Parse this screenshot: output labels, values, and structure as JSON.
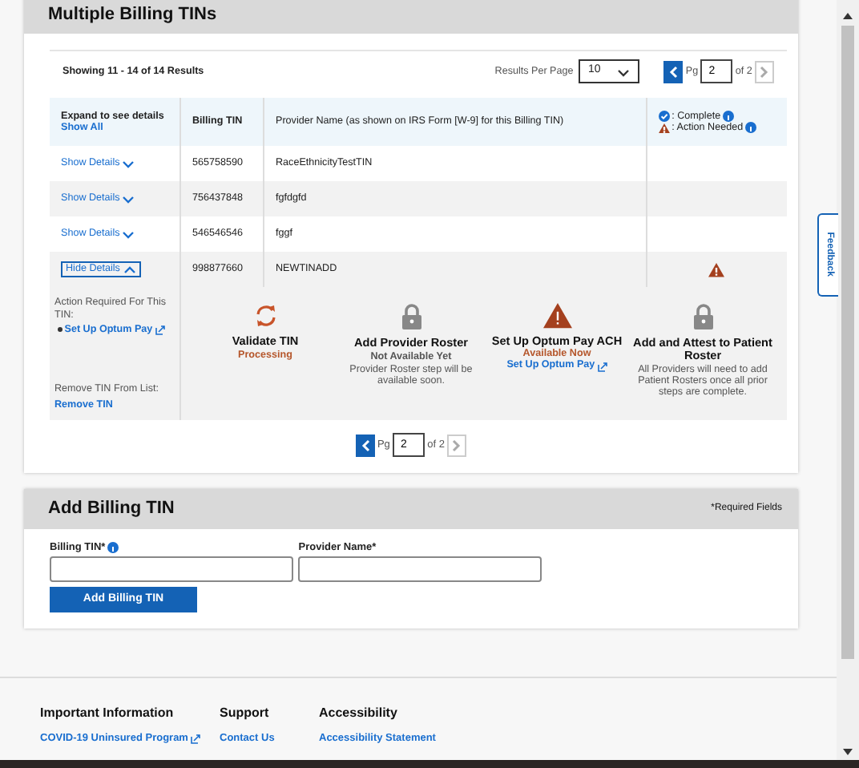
{
  "section_title": "Multiple Billing TINs",
  "summary": "Showing 11 - 14 of 14 Results",
  "per_page": {
    "label": "Results Per Page",
    "value": "10"
  },
  "pager_top": {
    "label": "Pg",
    "value": "2",
    "total": "of 2"
  },
  "columns": {
    "expand": "Expand to see details",
    "show_all": "Show All",
    "tin": "Billing TIN",
    "name": "Provider Name (as shown on IRS Form [W-9] for this Billing TIN)",
    "complete": ": Complete",
    "action": ": Action Needed"
  },
  "rows": [
    {
      "toggle": "Show Details",
      "expanded": false,
      "tin": "565758590",
      "name": "RaceEthnicityTestTIN",
      "action_needed": false
    },
    {
      "toggle": "Show Details",
      "expanded": false,
      "tin": "756437848",
      "name": "fgfdgfd",
      "action_needed": false
    },
    {
      "toggle": "Show Details",
      "expanded": false,
      "tin": "546546546",
      "name": "fggf",
      "action_needed": false
    },
    {
      "toggle": "Hide Details",
      "expanded": true,
      "tin": "998877660",
      "name": "NEWTINADD",
      "action_needed": true
    }
  ],
  "details": {
    "action_label": "Action Required For This TIN:",
    "action_link": "Set Up Optum Pay",
    "remove_label": "Remove TIN From List:",
    "remove_link": "Remove TIN",
    "steps": [
      {
        "kind": "processing",
        "title": "Validate TIN",
        "status": "Processing"
      },
      {
        "kind": "locked",
        "title": "Add Provider Roster",
        "status": "Not Available Yet",
        "note": "Provider Roster step will be available soon."
      },
      {
        "kind": "warning",
        "title": "Set Up Optum Pay ACH",
        "status": "Available Now",
        "link": "Set Up Optum Pay"
      },
      {
        "kind": "locked",
        "title": "Add and Attest to Patient Roster",
        "note": "All Providers will need to add Patient Rosters once all prior steps are complete."
      }
    ]
  },
  "pager_bottom": {
    "label": "Pg",
    "value": "2",
    "total": "of 2"
  },
  "add_form": {
    "title": "Add Billing TIN",
    "required_note": "*Required Fields",
    "tin_label": "Billing TIN*",
    "name_label": "Provider Name*",
    "button": "Add Billing TIN"
  },
  "footer": [
    {
      "heading": "Important Information",
      "link": "COVID-19 Uninsured Program",
      "external": true
    },
    {
      "heading": "Support",
      "link": "Contact Us",
      "external": false
    },
    {
      "heading": "Accessibility",
      "link": "Accessibility Statement",
      "external": false
    }
  ],
  "feedback": "Feedback"
}
